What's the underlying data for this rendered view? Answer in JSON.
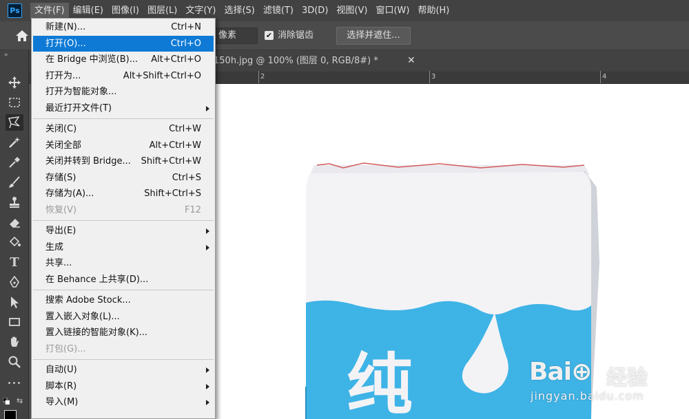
{
  "app": {
    "logo_text": "Ps"
  },
  "menubar": {
    "items": [
      "文件(F)",
      "编辑(E)",
      "图像(I)",
      "图层(L)",
      "文字(Y)",
      "选择(S)",
      "滤镜(T)",
      "3D(D)",
      "视图(V)",
      "窗口(W)",
      "帮助(H)"
    ],
    "active_index": 0
  },
  "options": {
    "pixel_unit": "像素",
    "antialias_checked": true,
    "antialias_check_glyph": "✔",
    "antialias_label": "消除锯齿",
    "select_mask_label": "选择并遮住..."
  },
  "toolbar": {
    "collapse_glyph": "»",
    "type_tool_glyph": "T",
    "more_glyph": "•••",
    "swap_glyph": "⇆",
    "foreground_color": "#000000",
    "active_tool": "polygonal-lasso-tool"
  },
  "document": {
    "tab_title": "150h.jpg @ 100% (图层 0, RGB/8#) *",
    "close_glyph": "✕"
  },
  "ruler": {
    "labels": [
      "2",
      "3",
      "4"
    ]
  },
  "file_menu": {
    "groups": [
      [
        {
          "label": "新建(N)...",
          "shortcut": "Ctrl+N"
        },
        {
          "label": "打开(O)...",
          "shortcut": "Ctrl+O",
          "highlighted": true
        },
        {
          "label": "在 Bridge 中浏览(B)...",
          "shortcut": "Alt+Ctrl+O"
        },
        {
          "label": "打开为...",
          "shortcut": "Alt+Shift+Ctrl+O"
        },
        {
          "label": "打开为智能对象...",
          "shortcut": ""
        },
        {
          "label": "最近打开文件(T)",
          "shortcut": "",
          "submenu": true
        }
      ],
      [
        {
          "label": "关闭(C)",
          "shortcut": "Ctrl+W"
        },
        {
          "label": "关闭全部",
          "shortcut": "Alt+Ctrl+W"
        },
        {
          "label": "关闭并转到 Bridge...",
          "shortcut": "Shift+Ctrl+W"
        },
        {
          "label": "存储(S)",
          "shortcut": "Ctrl+S"
        },
        {
          "label": "存储为(A)...",
          "shortcut": "Shift+Ctrl+S"
        },
        {
          "label": "恢复(V)",
          "shortcut": "F12",
          "disabled": true
        }
      ],
      [
        {
          "label": "导出(E)",
          "shortcut": "",
          "submenu": true
        },
        {
          "label": "生成",
          "shortcut": "",
          "submenu": true
        },
        {
          "label": "共享...",
          "shortcut": ""
        },
        {
          "label": "在 Behance 上共享(D)...",
          "shortcut": ""
        }
      ],
      [
        {
          "label": "搜索 Adobe Stock...",
          "shortcut": ""
        },
        {
          "label": "置入嵌入对象(L)...",
          "shortcut": ""
        },
        {
          "label": "置入链接的智能对象(K)...",
          "shortcut": ""
        },
        {
          "label": "打包(G)...",
          "shortcut": "",
          "disabled": true
        }
      ],
      [
        {
          "label": "自动(U)",
          "shortcut": "",
          "submenu": true
        },
        {
          "label": "脚本(R)",
          "shortcut": "",
          "submenu": true
        },
        {
          "label": "导入(M)",
          "shortcut": "",
          "submenu": true
        }
      ]
    ]
  },
  "canvas_image": {
    "carton_blue": "#3eb3e6",
    "carton_white": "#f3f3f6",
    "carton_text": "纯"
  },
  "watermark": {
    "logo": "Bai⊕",
    "cn": "经验",
    "url": "jingyan.baidu.com"
  }
}
